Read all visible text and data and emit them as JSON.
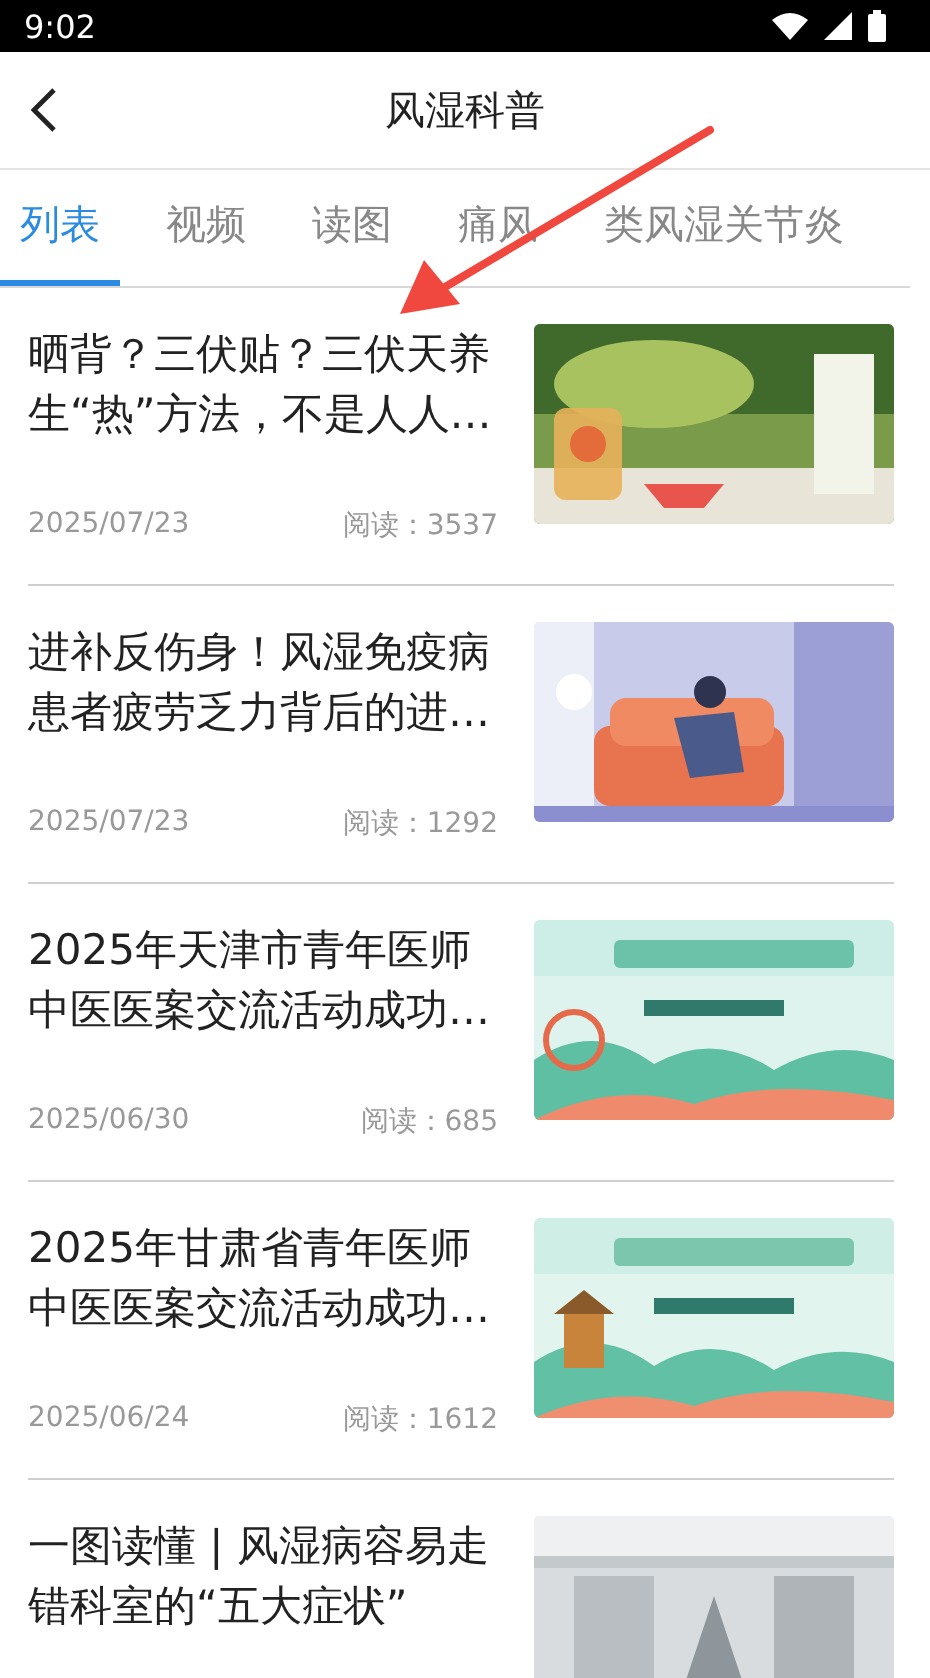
{
  "status_bar": {
    "time": "9:02"
  },
  "header": {
    "title": "风湿科普"
  },
  "tabs": [
    {
      "label": "列表",
      "selected": true
    },
    {
      "label": "视频",
      "selected": false
    },
    {
      "label": "读图",
      "selected": false
    },
    {
      "label": "痛风",
      "selected": false
    },
    {
      "label": "类风湿关节炎",
      "selected": false
    }
  ],
  "articles": [
    {
      "title": "晒背？三伏贴？三伏天养生“热”方法，不是人人…",
      "date": "2025/07/23",
      "reads": "阅读：3537"
    },
    {
      "title": "进补反伤身！风湿免疫病患者疲劳乏力背后的进…",
      "date": "2025/07/23",
      "reads": "阅读：1292"
    },
    {
      "title": "2025年天津市青年医师中医医案交流活动成功…",
      "date": "2025/06/30",
      "reads": "阅读：685"
    },
    {
      "title": "2025年甘肃省青年医师中医医案交流活动成功…",
      "date": "2025/06/24",
      "reads": "阅读：1612"
    },
    {
      "title": "一图读懂 | 风湿病容易走错科室的“五大症状”"
    }
  ]
}
